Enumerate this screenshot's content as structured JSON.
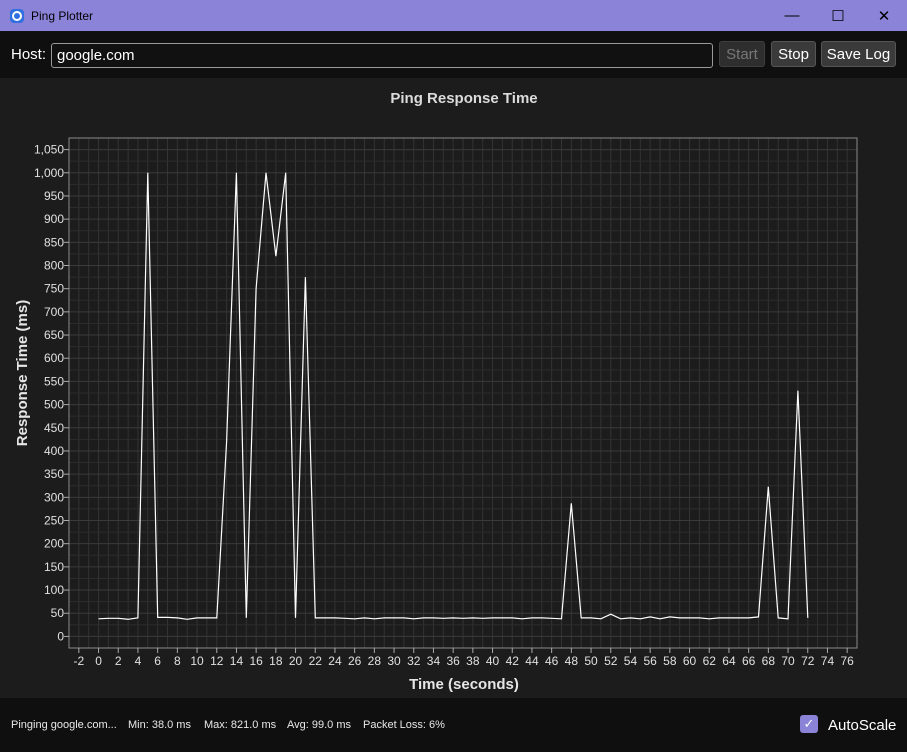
{
  "window": {
    "title": "Ping Plotter",
    "minimize_glyph": "—",
    "maximize_glyph": "☐",
    "close_glyph": "✕",
    "accent_color": "#8b83d8"
  },
  "toolbar": {
    "host_label": "Host:",
    "host_value": "google.com",
    "start_label": "Start",
    "stop_label": "Stop",
    "save_log_label": "Save Log"
  },
  "chart_data": {
    "type": "line",
    "title": "Ping Response Time",
    "xlabel": "Time (seconds)",
    "ylabel": "Response Time (ms)",
    "xlim": [
      -3,
      77
    ],
    "ylim": [
      -25,
      1075
    ],
    "xticks": [
      -2,
      0,
      2,
      4,
      6,
      8,
      10,
      12,
      14,
      16,
      18,
      20,
      22,
      24,
      26,
      28,
      30,
      32,
      34,
      36,
      38,
      40,
      42,
      44,
      46,
      48,
      50,
      52,
      54,
      56,
      58,
      60,
      62,
      64,
      66,
      68,
      70,
      72,
      74,
      76
    ],
    "yticks": [
      0,
      50,
      100,
      150,
      200,
      250,
      300,
      350,
      400,
      450,
      500,
      550,
      600,
      650,
      700,
      750,
      800,
      850,
      900,
      950,
      1000,
      1050
    ],
    "grid": true,
    "line_color": "#ffffff",
    "x": [
      0,
      1,
      2,
      3,
      4,
      5,
      6,
      7,
      8,
      9,
      10,
      11,
      12,
      13,
      14,
      15,
      16,
      17,
      18,
      19,
      20,
      21,
      22,
      23,
      24,
      25,
      26,
      27,
      28,
      29,
      30,
      31,
      32,
      33,
      34,
      35,
      36,
      37,
      38,
      39,
      40,
      41,
      42,
      43,
      44,
      45,
      46,
      47,
      48,
      49,
      50,
      51,
      52,
      53,
      54,
      55,
      56,
      57,
      58,
      59,
      60,
      61,
      62,
      63,
      64,
      65,
      66,
      67,
      68,
      69,
      70,
      71,
      72
    ],
    "y": [
      38,
      39,
      39,
      37,
      40,
      1000,
      41,
      41,
      40,
      37,
      40,
      40,
      40,
      420,
      1000,
      40,
      750,
      1000,
      820,
      1000,
      40,
      775,
      40,
      40,
      40,
      39,
      38,
      40,
      38,
      40,
      40,
      40,
      38,
      40,
      40,
      39,
      40,
      39,
      40,
      39,
      40,
      40,
      40,
      38,
      40,
      40,
      39,
      38,
      287,
      40,
      40,
      38,
      48,
      38,
      40,
      38,
      42,
      38,
      42,
      40,
      40,
      40,
      38,
      40,
      40,
      40,
      40,
      42,
      323,
      40,
      38,
      530,
      40
    ]
  },
  "status": {
    "state": "Pinging google.com...",
    "min": "Min: 38.0 ms",
    "max": "Max: 821.0 ms",
    "avg": "Avg: 99.0 ms",
    "loss": "Packet Loss: 6%",
    "check_glyph": "✓",
    "autoscale_label": "AutoScale"
  }
}
